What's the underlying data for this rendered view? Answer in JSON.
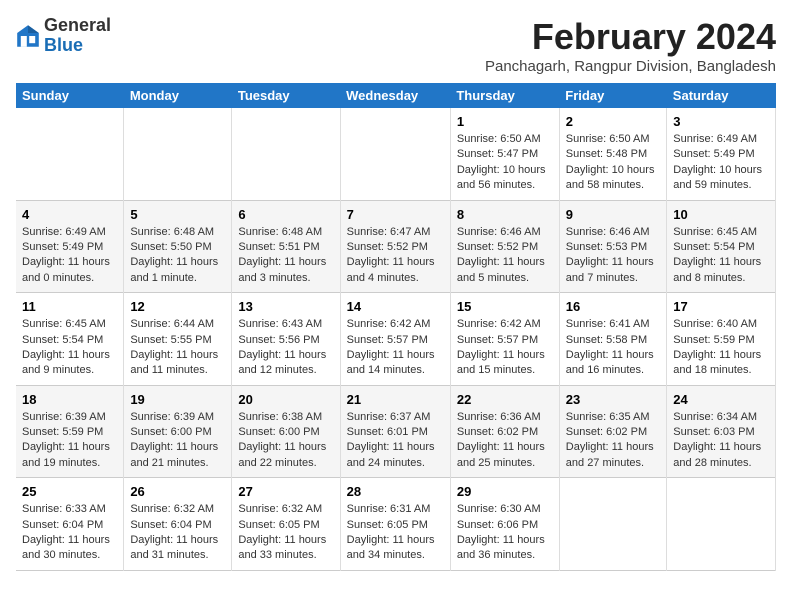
{
  "header": {
    "logo_general": "General",
    "logo_blue": "Blue",
    "month_title": "February 2024",
    "location": "Panchagarh, Rangpur Division, Bangladesh"
  },
  "days_of_week": [
    "Sunday",
    "Monday",
    "Tuesday",
    "Wednesday",
    "Thursday",
    "Friday",
    "Saturday"
  ],
  "weeks": [
    [
      {
        "day": "",
        "info": ""
      },
      {
        "day": "",
        "info": ""
      },
      {
        "day": "",
        "info": ""
      },
      {
        "day": "",
        "info": ""
      },
      {
        "day": "1",
        "info": "Sunrise: 6:50 AM\nSunset: 5:47 PM\nDaylight: 10 hours and 56 minutes."
      },
      {
        "day": "2",
        "info": "Sunrise: 6:50 AM\nSunset: 5:48 PM\nDaylight: 10 hours and 58 minutes."
      },
      {
        "day": "3",
        "info": "Sunrise: 6:49 AM\nSunset: 5:49 PM\nDaylight: 10 hours and 59 minutes."
      }
    ],
    [
      {
        "day": "4",
        "info": "Sunrise: 6:49 AM\nSunset: 5:49 PM\nDaylight: 11 hours and 0 minutes."
      },
      {
        "day": "5",
        "info": "Sunrise: 6:48 AM\nSunset: 5:50 PM\nDaylight: 11 hours and 1 minute."
      },
      {
        "day": "6",
        "info": "Sunrise: 6:48 AM\nSunset: 5:51 PM\nDaylight: 11 hours and 3 minutes."
      },
      {
        "day": "7",
        "info": "Sunrise: 6:47 AM\nSunset: 5:52 PM\nDaylight: 11 hours and 4 minutes."
      },
      {
        "day": "8",
        "info": "Sunrise: 6:46 AM\nSunset: 5:52 PM\nDaylight: 11 hours and 5 minutes."
      },
      {
        "day": "9",
        "info": "Sunrise: 6:46 AM\nSunset: 5:53 PM\nDaylight: 11 hours and 7 minutes."
      },
      {
        "day": "10",
        "info": "Sunrise: 6:45 AM\nSunset: 5:54 PM\nDaylight: 11 hours and 8 minutes."
      }
    ],
    [
      {
        "day": "11",
        "info": "Sunrise: 6:45 AM\nSunset: 5:54 PM\nDaylight: 11 hours and 9 minutes."
      },
      {
        "day": "12",
        "info": "Sunrise: 6:44 AM\nSunset: 5:55 PM\nDaylight: 11 hours and 11 minutes."
      },
      {
        "day": "13",
        "info": "Sunrise: 6:43 AM\nSunset: 5:56 PM\nDaylight: 11 hours and 12 minutes."
      },
      {
        "day": "14",
        "info": "Sunrise: 6:42 AM\nSunset: 5:57 PM\nDaylight: 11 hours and 14 minutes."
      },
      {
        "day": "15",
        "info": "Sunrise: 6:42 AM\nSunset: 5:57 PM\nDaylight: 11 hours and 15 minutes."
      },
      {
        "day": "16",
        "info": "Sunrise: 6:41 AM\nSunset: 5:58 PM\nDaylight: 11 hours and 16 minutes."
      },
      {
        "day": "17",
        "info": "Sunrise: 6:40 AM\nSunset: 5:59 PM\nDaylight: 11 hours and 18 minutes."
      }
    ],
    [
      {
        "day": "18",
        "info": "Sunrise: 6:39 AM\nSunset: 5:59 PM\nDaylight: 11 hours and 19 minutes."
      },
      {
        "day": "19",
        "info": "Sunrise: 6:39 AM\nSunset: 6:00 PM\nDaylight: 11 hours and 21 minutes."
      },
      {
        "day": "20",
        "info": "Sunrise: 6:38 AM\nSunset: 6:00 PM\nDaylight: 11 hours and 22 minutes."
      },
      {
        "day": "21",
        "info": "Sunrise: 6:37 AM\nSunset: 6:01 PM\nDaylight: 11 hours and 24 minutes."
      },
      {
        "day": "22",
        "info": "Sunrise: 6:36 AM\nSunset: 6:02 PM\nDaylight: 11 hours and 25 minutes."
      },
      {
        "day": "23",
        "info": "Sunrise: 6:35 AM\nSunset: 6:02 PM\nDaylight: 11 hours and 27 minutes."
      },
      {
        "day": "24",
        "info": "Sunrise: 6:34 AM\nSunset: 6:03 PM\nDaylight: 11 hours and 28 minutes."
      }
    ],
    [
      {
        "day": "25",
        "info": "Sunrise: 6:33 AM\nSunset: 6:04 PM\nDaylight: 11 hours and 30 minutes."
      },
      {
        "day": "26",
        "info": "Sunrise: 6:32 AM\nSunset: 6:04 PM\nDaylight: 11 hours and 31 minutes."
      },
      {
        "day": "27",
        "info": "Sunrise: 6:32 AM\nSunset: 6:05 PM\nDaylight: 11 hours and 33 minutes."
      },
      {
        "day": "28",
        "info": "Sunrise: 6:31 AM\nSunset: 6:05 PM\nDaylight: 11 hours and 34 minutes."
      },
      {
        "day": "29",
        "info": "Sunrise: 6:30 AM\nSunset: 6:06 PM\nDaylight: 11 hours and 36 minutes."
      },
      {
        "day": "",
        "info": ""
      },
      {
        "day": "",
        "info": ""
      }
    ]
  ]
}
